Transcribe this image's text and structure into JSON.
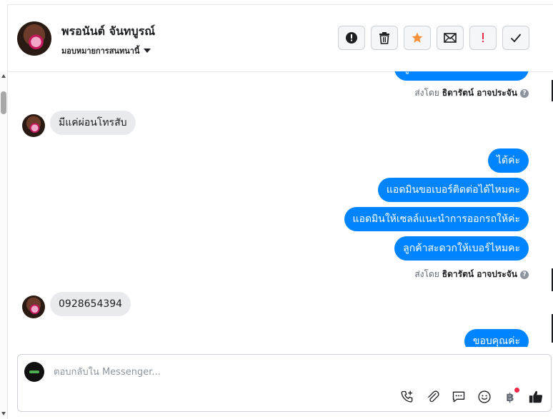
{
  "header": {
    "name": "พรอนันต์ จันทบูรณ์",
    "assign_label": "มอบหมายการสนทนานี้"
  },
  "actions": [
    {
      "icon": "alert-circle-icon"
    },
    {
      "icon": "trash-icon"
    },
    {
      "icon": "star-icon",
      "color": "#f7923b"
    },
    {
      "icon": "envelope-icon"
    },
    {
      "icon": "exclamation-icon",
      "color": "#f02849"
    },
    {
      "icon": "check-icon"
    }
  ],
  "messages": {
    "out_0": "ลูกค้าสะดวกให้เบอร์ไหมคะ",
    "sent_by_prefix": "ส่งโดย",
    "sent_by_name": "ธิดารัตน์ อาจประจัน",
    "in_1": "มีแค่ผ่อนโทรสับ",
    "out_2": "ได้ค่ะ",
    "out_3": "แอดมินขอเบอร์ติดต่อได้ไหมคะ",
    "out_4": "แอดมินให้เซลล์แนะนำการออกรถให้ค่ะ",
    "out_5": "ลูกค้าสะดวกให้เบอร์ไหมคะ",
    "in_6": "0928654394",
    "out_7": "ขอบคุณค่ะ"
  },
  "composer": {
    "placeholder": "ตอบกลับใน Messenger...",
    "tools": [
      "phone-plus-icon",
      "paperclip-icon",
      "chat-bubble-icon",
      "smiley-icon",
      "baht-icon",
      "thumbs-up-icon"
    ]
  },
  "colors": {
    "bubble_out": "#0084ff",
    "bubble_in": "#e9eaed",
    "accent_blue": "#1877f2"
  }
}
